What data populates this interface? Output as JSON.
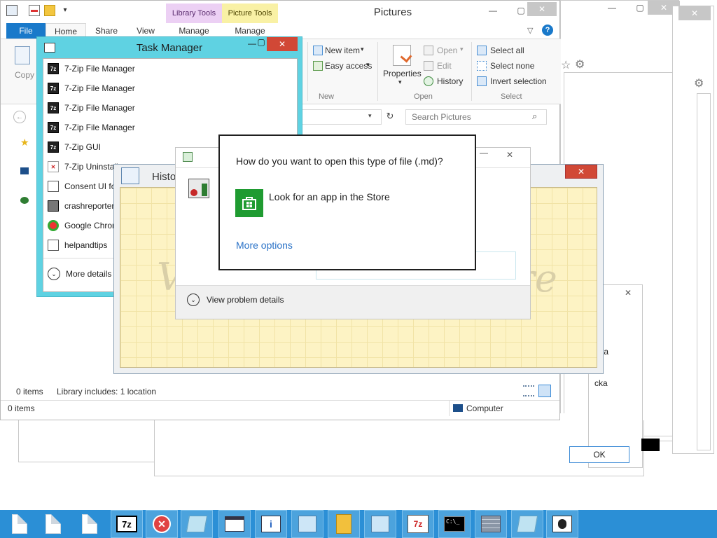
{
  "explorer": {
    "title": "Pictures",
    "context_tabs": {
      "library_tools": "Library Tools",
      "picture_tools": "Picture Tools"
    },
    "menu_tabs": {
      "file": "File",
      "home": "Home",
      "share": "Share",
      "view": "View",
      "manage1": "Manage",
      "manage2": "Manage"
    },
    "ribbon": {
      "copy": "Copy",
      "new_item": "New item",
      "easy_access": "Easy access",
      "new_group": "New",
      "properties": "Properties",
      "open": "Open",
      "edit": "Edit",
      "history": "History",
      "open_group": "Open",
      "select_all": "Select all",
      "select_none": "Select none",
      "invert_selection": "Invert selection",
      "select_group": "Select"
    },
    "search_placeholder": "Search Pictures",
    "status_items": "0 items",
    "library_includes": "Library includes: 1 location",
    "bottom_items": "0 items",
    "computer": "Computer"
  },
  "task_manager": {
    "title": "Task Manager",
    "processes": [
      "7-Zip File Manager",
      "7-Zip File Manager",
      "7-Zip File Manager",
      "7-Zip File Manager",
      "7-Zip GUI",
      "7-Zip Uninstall",
      "Consent UI fo",
      "crashreporter",
      "Google Chron",
      "helpandtips"
    ],
    "more_details": "More details"
  },
  "history_window": {
    "title": "Histo"
  },
  "problem_window": {
    "view_details": "View problem details"
  },
  "open_with": {
    "question": "How do you want to open this type of file (.md)?",
    "store_option": "Look for an app in the Store",
    "more_options": "More options"
  },
  "right_windows": {
    "item1": "ta",
    "item2": "cka",
    "ok": "OK"
  },
  "taskbar": {
    "icons": [
      "file-icon",
      "file-icon",
      "file-icon",
      "7zip-icon",
      "error-icon",
      "window-icon",
      "window-icon",
      "ie-icon",
      "window-icon",
      "folder-icon",
      "window-icon",
      "7zip-uninstall-icon",
      "cmd-icon",
      "firewall-icon",
      "window-icon",
      "bug-icon"
    ]
  },
  "colors": {
    "accent": "#1979ca",
    "taskbar": "#2b8fd6",
    "task_manager_frame": "#5fd2e2",
    "close_red": "#e04343"
  }
}
